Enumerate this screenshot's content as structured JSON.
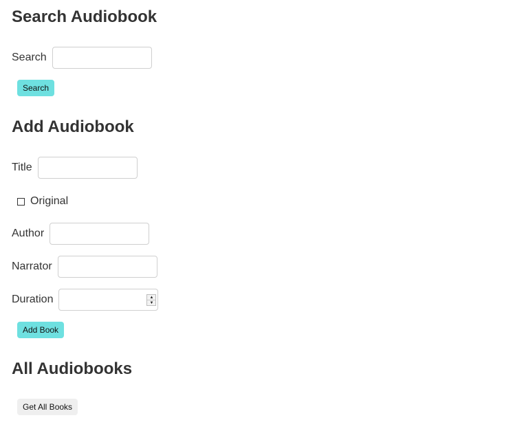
{
  "search_section": {
    "heading": "Search Audiobook",
    "search_label": "Search",
    "search_value": "",
    "search_button": "Search"
  },
  "add_section": {
    "heading": "Add Audiobook",
    "title_label": "Title",
    "title_value": "",
    "original_label": "Original",
    "original_checked": false,
    "author_label": "Author",
    "author_value": "",
    "narrator_label": "Narrator",
    "narrator_value": "",
    "duration_label": "Duration",
    "duration_value": "",
    "add_button": "Add Book"
  },
  "all_section": {
    "heading": "All Audiobooks",
    "get_all_button": "Get All Books"
  },
  "colors": {
    "primary_button": "#6ee0e0",
    "plain_button": "#efefef",
    "text": "#333333"
  }
}
